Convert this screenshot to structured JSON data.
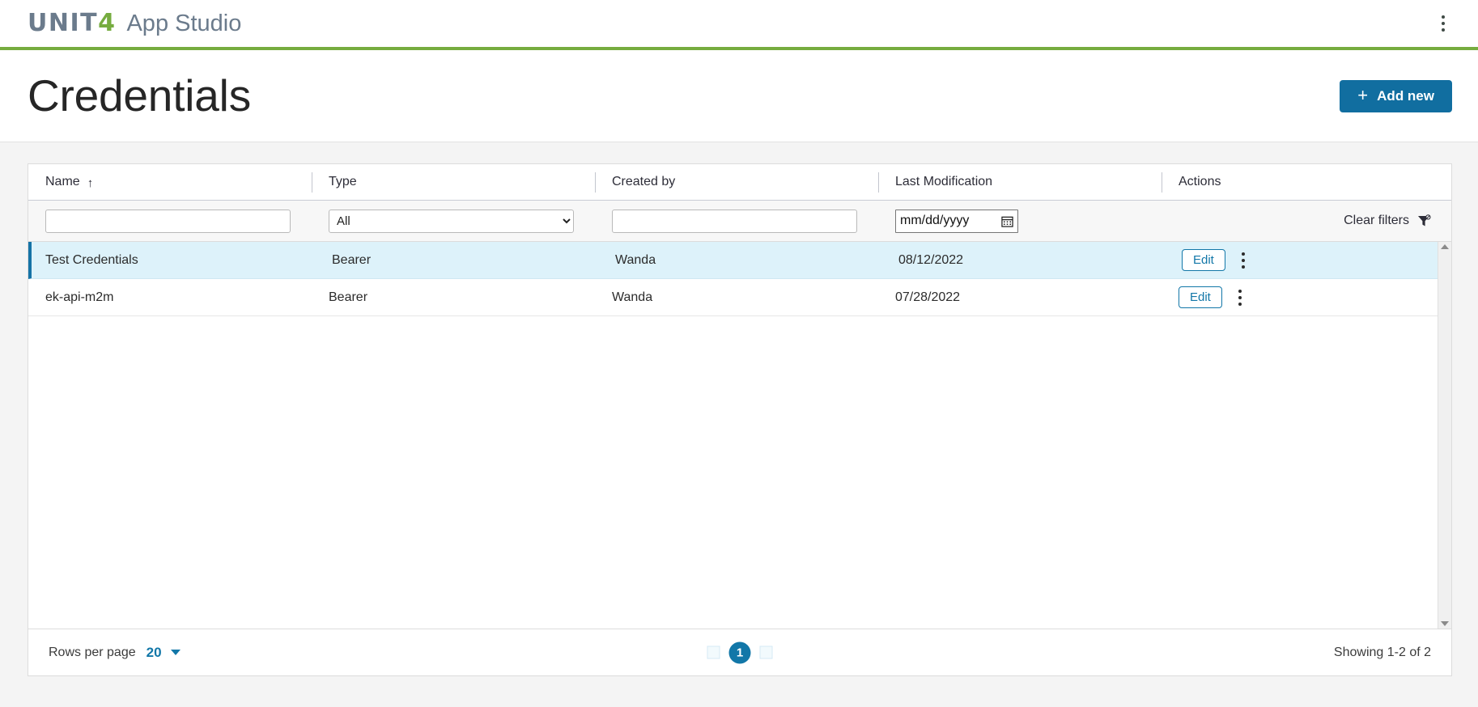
{
  "topbar": {
    "logo_main": "UNIT",
    "logo_accent": "4",
    "app_name": "App Studio",
    "menu_icon": "kebab-menu-icon",
    "accent_green": "#76ac3f",
    "logo_gray": "#6b7b8c"
  },
  "page": {
    "title": "Credentials",
    "add_button_label": "Add new",
    "add_button_icon": "plus-icon",
    "add_button_color": "#116ea0"
  },
  "table": {
    "columns": [
      {
        "label": "Name",
        "sort_icon": "arrow-up-icon",
        "sorted": true
      },
      {
        "label": "Type",
        "sort_icon": "",
        "sorted": false
      },
      {
        "label": "Created by",
        "sort_icon": "",
        "sorted": false
      },
      {
        "label": "Last Modification",
        "sort_icon": "",
        "sorted": false
      },
      {
        "label": "Actions",
        "sort_icon": "",
        "sorted": false
      }
    ],
    "filters": {
      "name_value": "",
      "name_placeholder": "",
      "type_selected": "All",
      "type_options": [
        "All"
      ],
      "created_by_value": "",
      "created_by_placeholder": "",
      "date_placeholder": "mm/dd/yyyy",
      "date_value": "",
      "date_icon": "calendar-icon",
      "clear_filters_label": "Clear filters",
      "clear_filters_icon": "filter-clear-icon"
    },
    "rows": [
      {
        "name": "Test Credentials",
        "type": "Bearer",
        "created_by": "Wanda",
        "last_modification": "08/12/2022",
        "edit_label": "Edit",
        "more_icon": "kebab-menu-icon",
        "selected": true
      },
      {
        "name": "ek-api-m2m",
        "type": "Bearer",
        "created_by": "Wanda",
        "last_modification": "07/28/2022",
        "edit_label": "Edit",
        "more_icon": "kebab-menu-icon",
        "selected": false
      }
    ],
    "selected_row_accent": "#1573a6",
    "selected_row_bg": "#ddf2fa"
  },
  "footer": {
    "rows_per_page_label": "Rows per page",
    "rows_per_page_value": "20",
    "rows_per_page_icon": "chevron-down-icon",
    "prev_page_icon": "prev-page-icon",
    "next_page_icon": "next-page-icon",
    "current_page": "1",
    "showing_text": "Showing 1-2 of 2"
  },
  "scrollbar": {
    "up_icon": "scroll-up-arrow-icon",
    "down_icon": "scroll-down-arrow-icon"
  }
}
